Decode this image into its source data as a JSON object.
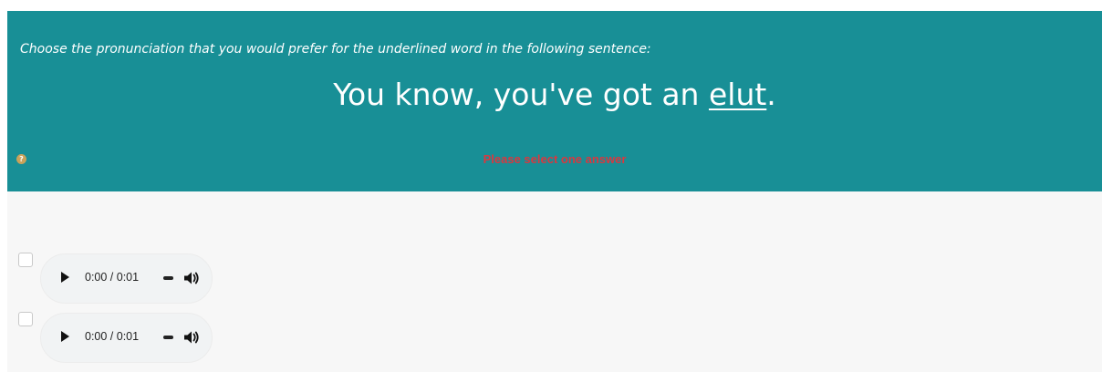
{
  "question": {
    "prompt": "Choose the pronunciation that you would prefer for the underlined word in the following sentence:",
    "sentence_before": "You know, you've got an ",
    "sentence_target": "elut",
    "sentence_after": ".",
    "help_icon_glyph": "?",
    "help_icon": "question-mark-icon",
    "validation_message": "Please select one answer"
  },
  "answers": [
    {
      "checked": false,
      "audio": {
        "time": "0:00 / 0:01",
        "play_icon": "play-icon",
        "volume_icon": "volume-icon"
      }
    },
    {
      "checked": false,
      "audio": {
        "time": "0:00 / 0:01",
        "play_icon": "play-icon",
        "volume_icon": "volume-icon"
      }
    }
  ],
  "colors": {
    "header_background": "#188f96",
    "page_background": "#f7f7f7",
    "validation_text": "#d8383f",
    "help_icon": "#c9a25a"
  }
}
